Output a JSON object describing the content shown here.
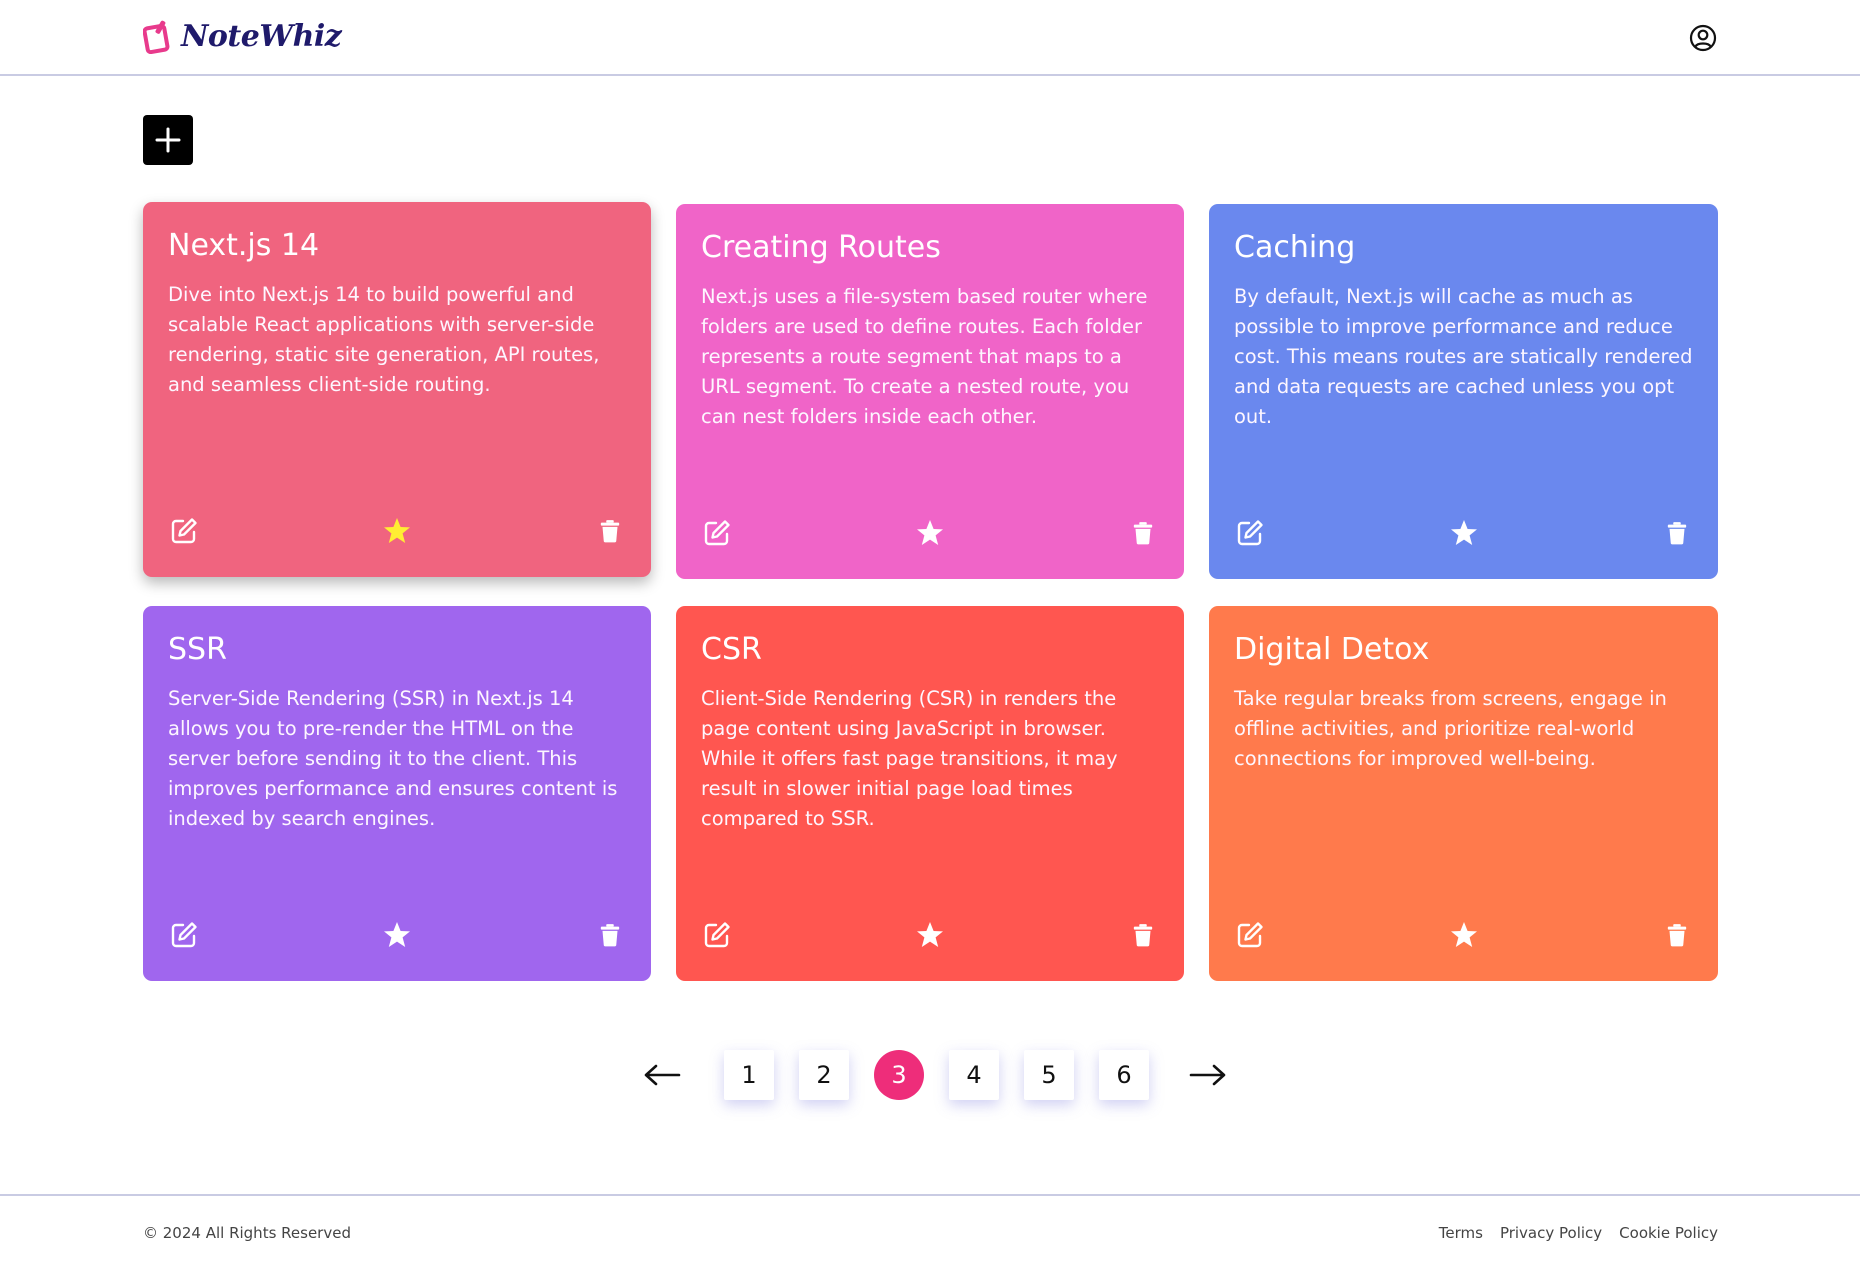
{
  "header": {
    "logo_text": "NoteWhiz",
    "user_icon": "user-circle-icon"
  },
  "toolbar": {
    "add_icon": "plus-icon"
  },
  "notes": [
    {
      "title": "Next.js 14",
      "body": "Dive into Next.js 14 to build powerful and scalable React applications with server-side rendering, static site generation, API routes, and seamless client-side routing.",
      "color": "#f0647f",
      "starred": true,
      "star_color": "#ffee33"
    },
    {
      "title": "Creating Routes",
      "body": "Next.js uses a file-system based router where folders are used to define routes. Each folder represents a route segment that maps to a URL segment. To create a nested route, you can nest folders inside each other.",
      "color": "#f064c8",
      "starred": false,
      "star_color": "#ffffff"
    },
    {
      "title": "Caching",
      "body": "By default, Next.js will cache as much as possible to improve performance and reduce cost. This means routes are statically rendered and data requests are cached unless you opt out.",
      "color": "#6a88ee",
      "starred": false,
      "star_color": "#ffffff"
    },
    {
      "title": "SSR",
      "body": "Server-Side Rendering (SSR) in Next.js 14 allows you to pre-render the HTML on the server before sending it to the client. This improves performance and ensures content is indexed by search engines.",
      "color": "#a066ee",
      "starred": false,
      "star_color": "#ffffff"
    },
    {
      "title": "CSR",
      "body": "Client-Side Rendering (CSR) in renders the page content using JavaScript in browser. While it offers fast page transitions, it may result in slower initial page load times compared to SSR.",
      "color": "#ff5650",
      "starred": false,
      "star_color": "#ffffff"
    },
    {
      "title": "Digital Detox",
      "body": "Take regular breaks from screens, engage in offline activities, and prioritize real-world connections for improved well-being.",
      "color": "#ff7a4c",
      "starred": false,
      "star_color": "#ffffff"
    }
  ],
  "pagination": {
    "pages": [
      "1",
      "2",
      "3",
      "4",
      "5",
      "6"
    ],
    "current": "3",
    "active_color": "#ee2d7a",
    "prev_icon": "arrow-left-icon",
    "next_icon": "arrow-right-icon"
  },
  "footer": {
    "copyright": "© 2024 All Rights Reserved",
    "links": [
      "Terms",
      "Privacy Policy",
      "Cookie Policy"
    ]
  }
}
